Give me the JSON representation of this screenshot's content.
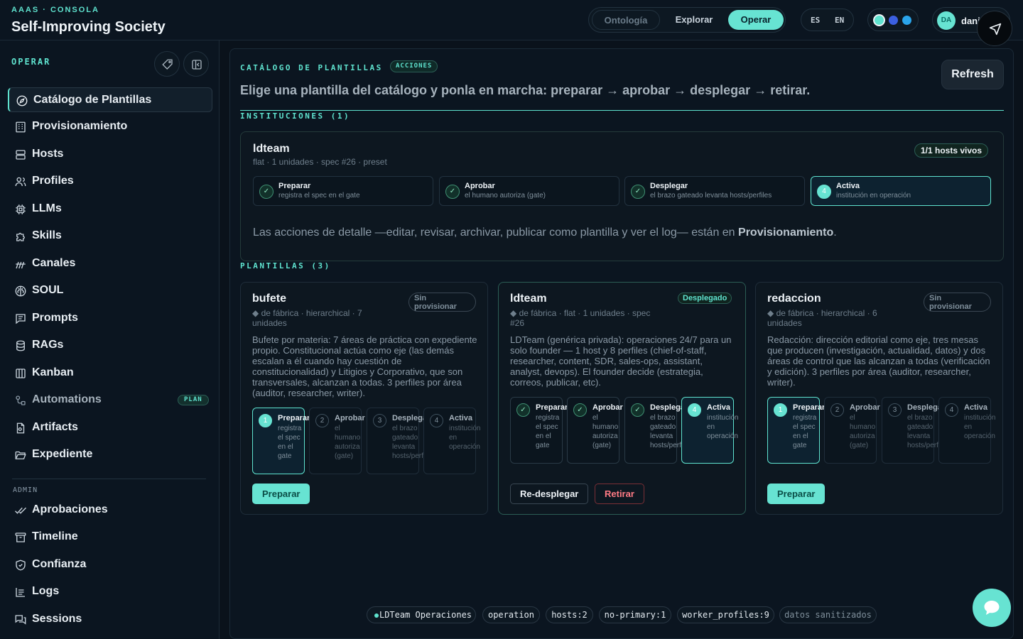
{
  "header": {
    "kicker": "AAAS · CONSOLA",
    "title": "Self-Improving Society",
    "modes": [
      "Ontología",
      "Explorar",
      "Operar"
    ],
    "active_mode": "Operar",
    "languages": [
      "ES",
      "EN"
    ],
    "theme_dots": [
      "#5fe3cf",
      "#3b5fe0",
      "#2aa4ea"
    ],
    "user_initials": "DA",
    "user_name": "dani"
  },
  "sidebar": {
    "section": "OPERAR",
    "items": [
      {
        "label": "Catálogo de Plantillas",
        "icon": "compass-icon",
        "active": true
      },
      {
        "label": "Provisionamiento",
        "icon": "building-icon"
      },
      {
        "label": "Hosts",
        "icon": "server-icon"
      },
      {
        "label": "Profiles",
        "icon": "users-icon"
      },
      {
        "label": "LLMs",
        "icon": "cpu-icon"
      },
      {
        "label": "Skills",
        "icon": "puzzle-icon"
      },
      {
        "label": "Canales",
        "icon": "signal-icon"
      },
      {
        "label": "SOUL",
        "icon": "brain-icon"
      },
      {
        "label": "Prompts",
        "icon": "message-square-icon"
      },
      {
        "label": "RAGs",
        "icon": "database-icon"
      },
      {
        "label": "Kanban",
        "icon": "kanban-icon"
      },
      {
        "label": "Automations",
        "icon": "workflow-icon",
        "badge": "PLAN"
      },
      {
        "label": "Artifacts",
        "icon": "file-cog-icon"
      },
      {
        "label": "Expediente",
        "icon": "folder-open-icon"
      }
    ],
    "admin_section": "ADMIN",
    "admin_items": [
      {
        "label": "Aprobaciones",
        "icon": "check-check-icon"
      },
      {
        "label": "Timeline",
        "icon": "archive-icon"
      },
      {
        "label": "Confianza",
        "icon": "shield-check-icon"
      },
      {
        "label": "Logs",
        "icon": "logs-icon"
      },
      {
        "label": "Sessions",
        "icon": "messages-icon"
      }
    ]
  },
  "main": {
    "kicker": "CATÁLOGO DE PLANTILLAS",
    "kicker_badge": "ACCIONES",
    "lead": "Elige una plantilla del catálogo y ponla en marcha: preparar → aprobar → desplegar → retirar.",
    "refresh_label": "Refresh",
    "institutions_header": "INSTITUCIONES (1)",
    "institution": {
      "title": "ldteam",
      "subtitle": "flat · 1 unidades · spec #26 · preset",
      "hosts_badge": "1/1 hosts vivos",
      "steps": [
        {
          "title": "Preparar",
          "desc": "registra el spec en el gate",
          "state": "done",
          "mark": "✓"
        },
        {
          "title": "Aprobar",
          "desc": "el humano autoriza (gate)",
          "state": "done",
          "mark": "✓"
        },
        {
          "title": "Desplegar",
          "desc": "el brazo gateado levanta hosts/perfiles",
          "state": "done",
          "mark": "✓"
        },
        {
          "title": "Activa",
          "desc": "institución en operación",
          "state": "current",
          "mark": "4"
        }
      ],
      "note_pre": "Las acciones de detalle —editar, revisar, archivar, publicar como plantilla y ver el log— están en ",
      "note_bold": "Provisionamiento",
      "note_post": "."
    },
    "templates_header": "PLANTILLAS (3)",
    "templates": [
      {
        "title": "bufete",
        "meta": "◆ de fábrica · hierarchical · 7 unidades",
        "status": "Sin provisionar",
        "desc": "Bufete por materia: 7 áreas de práctica con expediente propio. Constitucional actúa como eje (las demás escalan a él cuando hay cuestión de constitucionalidad) y Litigios y Corporativo, que son transversales, alcanzan a todas. 3 perfiles por área (auditor, researcher, writer).",
        "steps": [
          {
            "title": "Preparar",
            "desc": "registra el spec en el gate",
            "mark": "1",
            "state": "current"
          },
          {
            "title": "Aprobar",
            "desc": "el humano autoriza (gate)",
            "mark": "2",
            "state": "pending"
          },
          {
            "title": "Desplegar",
            "desc": "el brazo gateado levanta hosts/perfiles",
            "mark": "3",
            "state": "pending"
          },
          {
            "title": "Activa",
            "desc": "institución en operación",
            "mark": "4",
            "state": "pending"
          }
        ],
        "primary_action": "Preparar"
      },
      {
        "title": "ldteam",
        "meta": "◆ de fábrica · flat · 1 unidades · spec #26",
        "status": "Desplegado",
        "desc": "LDTeam (genérica privada): operaciones 24/7 para un solo founder — 1 host y 8 perfiles (chief-of-staff, researcher, content, SDR, sales-ops, assistant, analyst, devops). El founder decide (estrategia, correos, publicar, etc).",
        "steps": [
          {
            "title": "Preparar",
            "desc": "registra el spec en el gate",
            "mark": "✓",
            "state": "done"
          },
          {
            "title": "Aprobar",
            "desc": "el humano autoriza (gate)",
            "mark": "✓",
            "state": "done"
          },
          {
            "title": "Desplegar",
            "desc": "el brazo gateado levanta hosts/perfiles",
            "mark": "✓",
            "state": "done"
          },
          {
            "title": "Activa",
            "desc": "institución en operación",
            "mark": "4",
            "state": "current"
          }
        ],
        "actions": [
          "Re-desplegar",
          "Retirar"
        ]
      },
      {
        "title": "redaccion",
        "meta": "◆ de fábrica · hierarchical · 6 unidades",
        "status": "Sin provisionar",
        "desc": "Redacción: dirección editorial como eje, tres mesas que producen (investigación, actualidad, datos) y dos áreas de control que las alcanzan a todas (verificación y edición). 3 perfiles por área (auditor, researcher, writer).",
        "steps": [
          {
            "title": "Preparar",
            "desc": "registra el spec en el gate",
            "mark": "1",
            "state": "current"
          },
          {
            "title": "Aprobar",
            "desc": "el humano autoriza (gate)",
            "mark": "2",
            "state": "pending"
          },
          {
            "title": "Desplegar",
            "desc": "el brazo gateado levanta hosts/perfiles",
            "mark": "3",
            "state": "pending"
          },
          {
            "title": "Activa",
            "desc": "institución en operación",
            "mark": "4",
            "state": "pending"
          }
        ],
        "primary_action": "Preparar"
      }
    ]
  },
  "footer_chips": [
    {
      "label": "LDTeam Operaciones",
      "dot": true
    },
    {
      "label": "operation"
    },
    {
      "label": "hosts:2"
    },
    {
      "label": "no-primary:1"
    },
    {
      "label": "worker_profiles:9"
    },
    {
      "label": "datos sanitizados",
      "muted": true
    }
  ]
}
